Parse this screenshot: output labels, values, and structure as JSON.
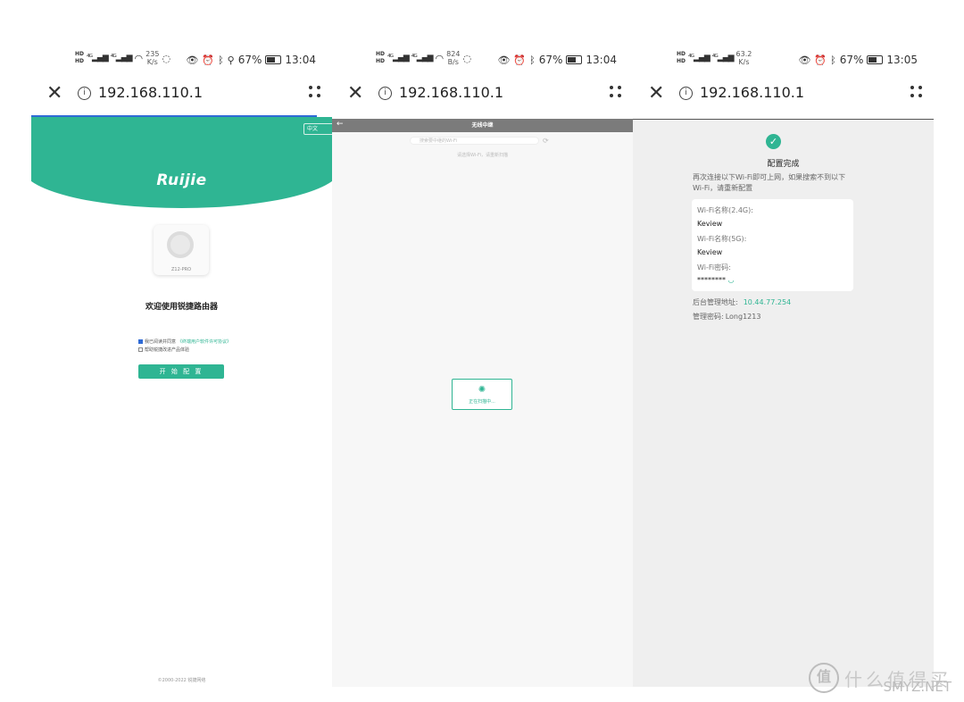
{
  "screens": [
    {
      "status": {
        "speed_value": "235",
        "speed_unit": "K/s",
        "battery": "67%",
        "time": "13:04"
      },
      "browser": {
        "url": "192.168.110.1"
      },
      "page": {
        "lang_button": "中文",
        "logo": "Ruijie",
        "device_model": "Z12-PRO",
        "welcome": "欢迎使用锐捷路由器",
        "agree_text": "我已阅读并同意",
        "agree_link": "《终端用户软件许可协议》",
        "improve_text": "帮助锐捷改进产品体验",
        "start_button": "开 始 配 置",
        "copyright": "©2000-2022 锐捷网络"
      }
    },
    {
      "status": {
        "speed_value": "824",
        "speed_unit": "B/s",
        "battery": "67%",
        "time": "13:04"
      },
      "browser": {
        "url": "192.168.110.1"
      },
      "page": {
        "title": "无线中继",
        "search_placeholder": "搜索要中继的Wi-Fi",
        "hint": "请选择Wi-Fi，请重新扫描",
        "loading": "正在扫描中..."
      }
    },
    {
      "status": {
        "speed_value": "63.2",
        "speed_unit": "K/s",
        "battery": "67%",
        "time": "13:05"
      },
      "browser": {
        "url": "192.168.110.1"
      },
      "page": {
        "done_title": "配置完成",
        "note": "再次连接以下Wi-Fi即可上网，如果搜索不到以下Wi-Fi，请重新配置",
        "wifi24_label": "Wi-Fi名称(2.4G):",
        "wifi24_value": "Keview",
        "wifi5_label": "Wi-Fi名称(5G):",
        "wifi5_value": "Keview",
        "pw_label": "Wi-Fi密码:",
        "pw_value": "********",
        "admin_addr_label": "后台管理地址:",
        "admin_addr_value": "10.44.77.254",
        "admin_pw_label": "管理密码:",
        "admin_pw_value": "Long1213"
      }
    }
  ],
  "watermark": {
    "badge": "值",
    "text": "什么值得买",
    "site": "SMYZ.NET"
  },
  "colors": {
    "accent": "#2fb593",
    "progress": "#2f6bd6",
    "titlebar": "#7b7b7b"
  }
}
